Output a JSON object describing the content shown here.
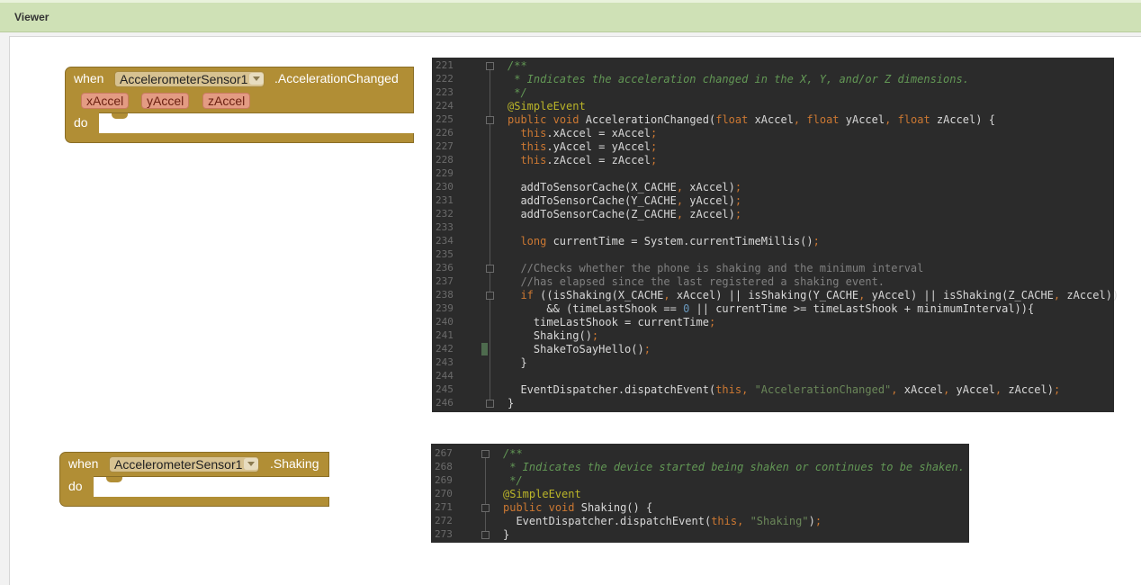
{
  "header": {
    "title": "Viewer"
  },
  "blocks": [
    {
      "when_label": "when",
      "component": "AccelerometerSensor1",
      "event": ".AccelerationChanged",
      "params": [
        "xAccel",
        "yAccel",
        "zAccel"
      ],
      "do_label": "do"
    },
    {
      "when_label": "when",
      "component": "AccelerometerSensor1",
      "event": ".Shaking",
      "params": [],
      "do_label": "do"
    }
  ],
  "code_panels": [
    {
      "lines": [
        {
          "n": "221",
          "t": "/**"
        },
        {
          "n": "222",
          "t": " * Indicates the acceleration changed in the X, Y, and/or Z dimensions."
        },
        {
          "n": "223",
          "t": " */"
        },
        {
          "n": "224",
          "t": "@SimpleEvent"
        },
        {
          "n": "225",
          "t": "public void AccelerationChanged(float xAccel, float yAccel, float zAccel) {"
        },
        {
          "n": "226",
          "t": "  this.xAccel = xAccel;"
        },
        {
          "n": "227",
          "t": "  this.yAccel = yAccel;"
        },
        {
          "n": "228",
          "t": "  this.zAccel = zAccel;"
        },
        {
          "n": "229",
          "t": ""
        },
        {
          "n": "230",
          "t": "  addToSensorCache(X_CACHE, xAccel);"
        },
        {
          "n": "231",
          "t": "  addToSensorCache(Y_CACHE, yAccel);"
        },
        {
          "n": "232",
          "t": "  addToSensorCache(Z_CACHE, zAccel);"
        },
        {
          "n": "233",
          "t": ""
        },
        {
          "n": "234",
          "t": "  long currentTime = System.currentTimeMillis();"
        },
        {
          "n": "235",
          "t": ""
        },
        {
          "n": "236",
          "t": "  //Checks whether the phone is shaking and the minimum interval"
        },
        {
          "n": "237",
          "t": "  //has elapsed since the last registered a shaking event."
        },
        {
          "n": "238",
          "t": "  if ((isShaking(X_CACHE, xAccel) || isShaking(Y_CACHE, yAccel) || isShaking(Z_CACHE, zAccel))"
        },
        {
          "n": "239",
          "t": "      && (timeLastShook == 0 || currentTime >= timeLastShook + minimumInterval)){"
        },
        {
          "n": "240",
          "t": "    timeLastShook = currentTime;"
        },
        {
          "n": "241",
          "t": "    Shaking();"
        },
        {
          "n": "242",
          "t": "    ShakeToSayHello();"
        },
        {
          "n": "243",
          "t": "  }"
        },
        {
          "n": "244",
          "t": ""
        },
        {
          "n": "245",
          "t": "  EventDispatcher.dispatchEvent(this, \"AccelerationChanged\", xAccel, yAccel, zAccel);"
        },
        {
          "n": "246",
          "t": "}"
        }
      ]
    },
    {
      "lines": [
        {
          "n": "267",
          "t": "/**"
        },
        {
          "n": "268",
          "t": " * Indicates the device started being shaken or continues to be shaken."
        },
        {
          "n": "269",
          "t": " */"
        },
        {
          "n": "270",
          "t": "@SimpleEvent"
        },
        {
          "n": "271",
          "t": "public void Shaking() {"
        },
        {
          "n": "272",
          "t": "  EventDispatcher.dispatchEvent(this, \"Shaking\");"
        },
        {
          "n": "273",
          "t": "}"
        }
      ]
    }
  ],
  "colors": {
    "block": "#b18e35",
    "param": "#e39b83",
    "code_bg": "#2b2b2b",
    "header_bg": "#cfe1b6"
  }
}
